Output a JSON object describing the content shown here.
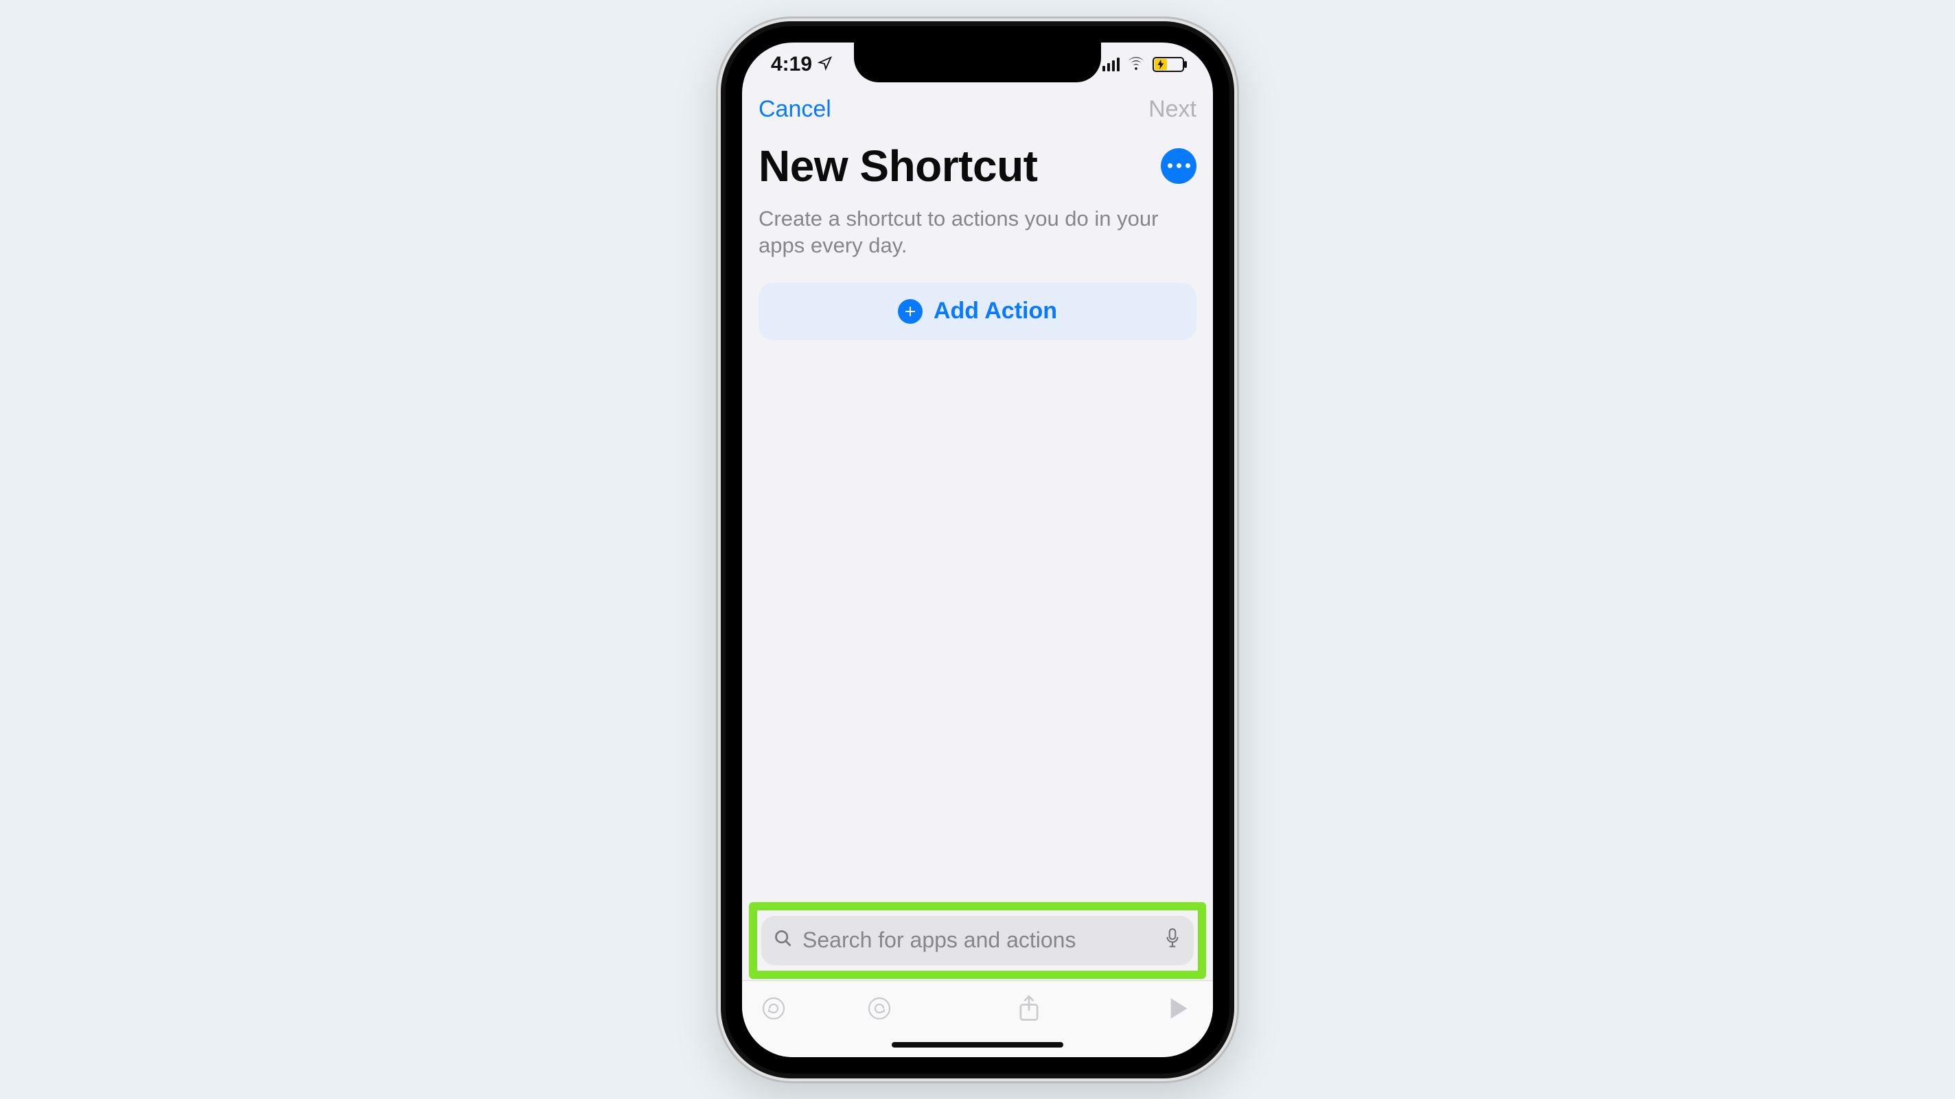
{
  "statusbar": {
    "time": "4:19",
    "location_icon": "location-arrow-icon",
    "cell_icon": "cellular-bars-icon",
    "wifi_icon": "wifi-icon",
    "battery_icon": "battery-charging-icon"
  },
  "nav": {
    "cancel_label": "Cancel",
    "next_label": "Next"
  },
  "header": {
    "title": "New Shortcut",
    "more_icon": "more-ellipsis-icon",
    "subtitle": "Create a shortcut to actions you do in your apps every day."
  },
  "main": {
    "add_action_label": "Add Action",
    "add_action_icon": "plus-circle-icon"
  },
  "search": {
    "placeholder": "Search for apps and actions",
    "search_icon": "search-icon",
    "mic_icon": "microphone-icon"
  },
  "toolbar": {
    "undo_icon": "undo-icon",
    "redo_icon": "redo-icon",
    "share_icon": "share-icon",
    "play_icon": "play-icon"
  },
  "colors": {
    "accent": "#087aff",
    "highlight": "#7fe32a",
    "screen_bg": "#f3f2f7",
    "add_btn_bg": "#e5edfa",
    "search_bg": "#e4e3e8",
    "disabled_text": "#b1b1b6",
    "secondary_text": "#868589",
    "outer_bg": "#ebf0f4",
    "battery_level": "#ffcc00"
  }
}
